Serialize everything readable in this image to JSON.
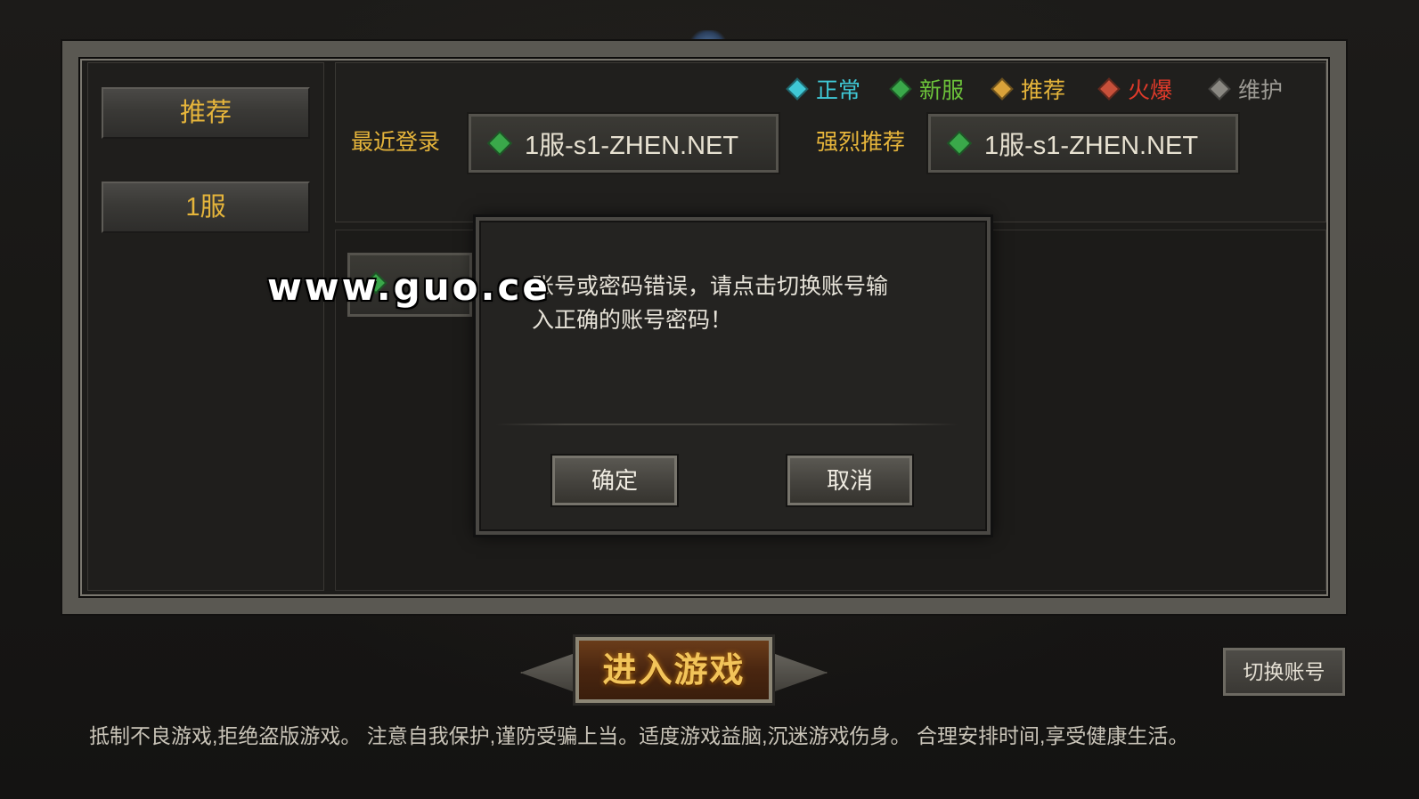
{
  "sidebar": {
    "items": [
      {
        "label": "推荐",
        "active": true
      },
      {
        "label": "1服",
        "active": false
      }
    ]
  },
  "legend": [
    {
      "label": "正常",
      "color": "#3fc8d6",
      "icon": "diamond-cyan-icon"
    },
    {
      "label": "新服",
      "color": "#6cc23a",
      "icon": "diamond-green-icon"
    },
    {
      "label": "推荐",
      "color": "#e6b53b",
      "icon": "diamond-gold-icon"
    },
    {
      "label": "火爆",
      "color": "#e03a2a",
      "icon": "diamond-red-icon"
    },
    {
      "label": "维护",
      "color": "#9c9a94",
      "icon": "diamond-gray-icon"
    }
  ],
  "recent": {
    "label": "最近登录",
    "server": "1服-s1-ZHEN.NET",
    "status_icon": "diamond-green-icon"
  },
  "recommended": {
    "label": "强烈推荐",
    "server": "1服-s1-ZHEN.NET",
    "status_icon": "diamond-green-icon"
  },
  "dialog": {
    "message_line1": "账号或密码错误，请点击切换账号输",
    "message_line2": "入正确的账号密码！",
    "confirm_label": "确定",
    "cancel_label": "取消"
  },
  "watermark": "www.guo.ce",
  "enter_game_label": "进入游戏",
  "switch_account_label": "切换账号",
  "notice": "抵制不良游戏,拒绝盗版游戏。 注意自我保护,谨防受骗上当。适度游戏益脑,沉迷游戏伤身。 合理安排时间,享受健康生活。",
  "colors": {
    "gold": "#e6b53b",
    "status_green": "#3aa84a"
  }
}
